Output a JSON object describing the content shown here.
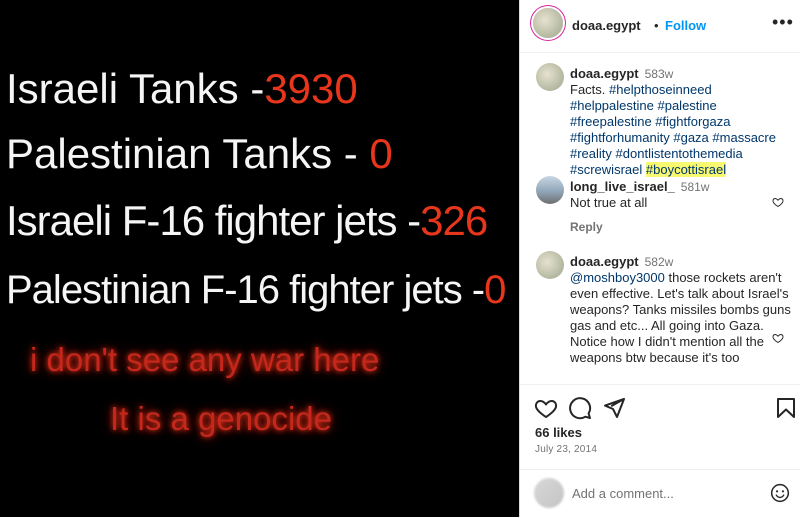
{
  "image": {
    "line1": {
      "white": "Israeli Tanks -",
      "red": "3930"
    },
    "line2": {
      "white": "Palestinian  Tanks - ",
      "red": "0"
    },
    "line3": {
      "white": "Israeli F-16  fighter jets -",
      "red": "326"
    },
    "line4": {
      "white": "Palestinian F-16  fighter jets -",
      "red": "0"
    },
    "line5": "i don't see any war here",
    "line6": "It is a genocide"
  },
  "header": {
    "username": "doaa.egypt",
    "separator": "•",
    "follow_label": "Follow",
    "more_label": "•••"
  },
  "caption": {
    "username": "doaa.egypt",
    "time": "583w",
    "text": "Facts.",
    "hashtags": [
      "#helpthoseinneed",
      "#helppalestine",
      "#palestine",
      "#freepalestine",
      "#fightforgaza",
      "#fightforhumanity",
      "#gaza",
      "#massacre",
      "#reality",
      "#dontlistentothemedia",
      "#screwisrael"
    ],
    "highlighted_hashtag": "#boycottisrael"
  },
  "comments": [
    {
      "username": "long_live_israel_",
      "time": "581w",
      "text": "Not true at all",
      "reply_label": "Reply"
    },
    {
      "username": "doaa.egypt",
      "time": "582w",
      "mention": "@moshboy3000",
      "text": " those rockets aren't even effective. Let's talk about Israel's weapons? Tanks missiles bombs guns gas and etc... All going into Gaza. Notice how I didn't mention all the weapons btw because it's too"
    }
  ],
  "footer": {
    "likes": "66 likes",
    "date": "July 23, 2014",
    "add_comment_placeholder": "Add a comment..."
  },
  "colors": {
    "link": "#00376b",
    "follow": "#0095f6",
    "highlight": "#f9f871",
    "image_red": "#e8361c"
  }
}
